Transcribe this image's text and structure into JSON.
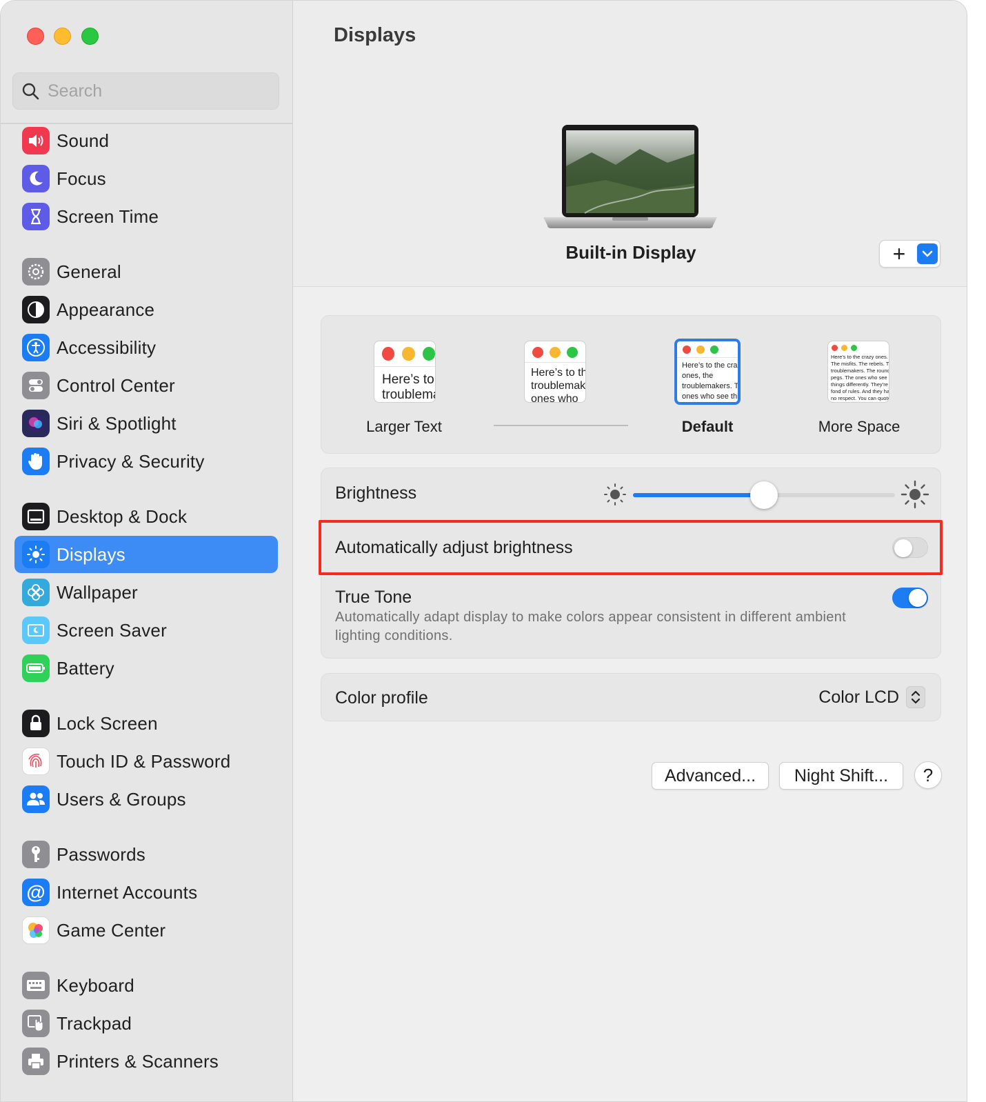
{
  "window": {
    "title": "Displays"
  },
  "search": {
    "placeholder": "Search"
  },
  "sidebar": {
    "items": [
      {
        "label": "Sound",
        "icon": "speaker-icon",
        "color": "#f0384f"
      },
      {
        "label": "Focus",
        "icon": "moon-icon",
        "color": "#5e5ce6"
      },
      {
        "label": "Screen Time",
        "icon": "hourglass-icon",
        "color": "#5e5ce6"
      },
      {
        "label": "General",
        "icon": "gear-icon",
        "color": "#8e8e93"
      },
      {
        "label": "Appearance",
        "icon": "appearance-icon",
        "color": "#1c1c1e"
      },
      {
        "label": "Accessibility",
        "icon": "accessibility-icon",
        "color": "#1c7cf3"
      },
      {
        "label": "Control Center",
        "icon": "control-center-icon",
        "color": "#8e8e93"
      },
      {
        "label": "Siri & Spotlight",
        "icon": "siri-icon",
        "color": "#2a2a5a"
      },
      {
        "label": "Privacy & Security",
        "icon": "hand-icon",
        "color": "#1c7cf3"
      },
      {
        "label": "Desktop & Dock",
        "icon": "dock-icon",
        "color": "#1c1c1e"
      },
      {
        "label": "Displays",
        "icon": "sun-icon",
        "color": "#1c7cf3",
        "active": true
      },
      {
        "label": "Wallpaper",
        "icon": "flower-icon",
        "color": "#34aadc"
      },
      {
        "label": "Screen Saver",
        "icon": "screen-saver-icon",
        "color": "#5ac8fa"
      },
      {
        "label": "Battery",
        "icon": "battery-icon",
        "color": "#30d158"
      },
      {
        "label": "Lock Screen",
        "icon": "lock-icon",
        "color": "#1c1c1e"
      },
      {
        "label": "Touch ID & Password",
        "icon": "fingerprint-icon",
        "color": "#ffffff"
      },
      {
        "label": "Users & Groups",
        "icon": "users-icon",
        "color": "#1c7cf3"
      },
      {
        "label": "Passwords",
        "icon": "key-icon",
        "color": "#8e8e93"
      },
      {
        "label": "Internet Accounts",
        "icon": "at-icon",
        "color": "#1c7cf3"
      },
      {
        "label": "Game Center",
        "icon": "game-center-icon",
        "color": "#ffffff"
      },
      {
        "label": "Keyboard",
        "icon": "keyboard-icon",
        "color": "#8e8e93"
      },
      {
        "label": "Trackpad",
        "icon": "trackpad-icon",
        "color": "#8e8e93"
      },
      {
        "label": "Printers & Scanners",
        "icon": "printer-icon",
        "color": "#8e8e93"
      }
    ]
  },
  "main": {
    "title": "Displays",
    "display_name": "Built-in Display",
    "add_button": "+",
    "resolution": {
      "options": [
        {
          "label": "Larger Text",
          "preview": "Here’s to the troublemakers"
        },
        {
          "label": "",
          "preview": "Here’s to the troublemakers. The ones who"
        },
        {
          "label": "Default",
          "selected": true,
          "preview": "Here’s to the crazy ones, the troublemakers. The ones who see things differently. They’re not fond of rules. And they"
        },
        {
          "label": "More Space",
          "preview": "Here’s to the crazy ones. The misfits. The rebels. The troublemakers. The round pegs. The ones who see things differently. They’re not fond of rules. And they have no respect. You can quote them, disagree with them. About the only thing you can’t do. Because they change things."
        }
      ]
    },
    "brightness": {
      "label": "Brightness",
      "value": 0.5
    },
    "auto_brightness": {
      "label": "Automatically adjust brightness",
      "enabled": false
    },
    "true_tone": {
      "label": "True Tone",
      "description": "Automatically adapt display to make colors appear consistent in different ambient lighting conditions.",
      "enabled": true
    },
    "color_profile": {
      "label": "Color profile",
      "value": "Color LCD"
    },
    "buttons": {
      "advanced": "Advanced...",
      "night_shift": "Night Shift...",
      "help": "?"
    }
  },
  "colors": {
    "accent": "#1c7cf3",
    "selection": "#3d8cf5",
    "highlight_box": "#f52b1e"
  }
}
